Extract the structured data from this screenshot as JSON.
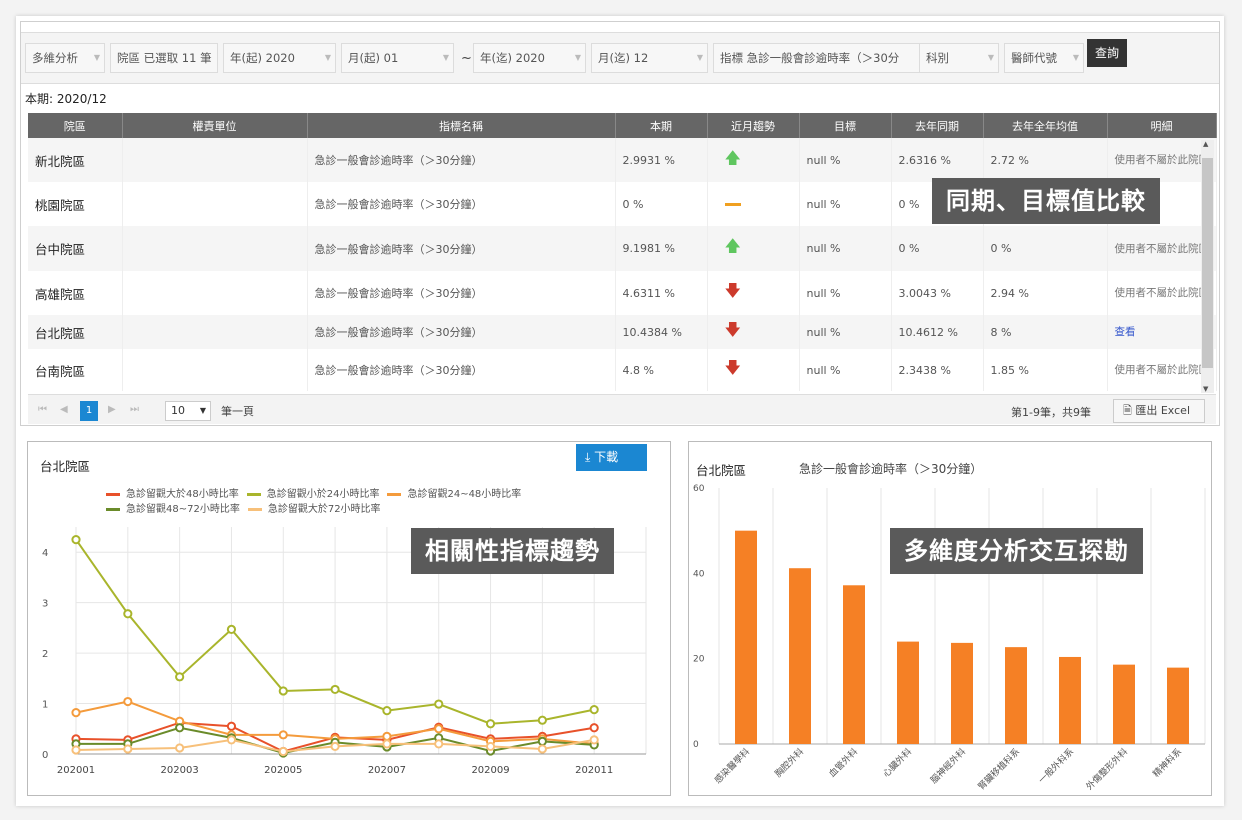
{
  "filters": {
    "dimension": "多維分析",
    "region": "院區 已選取 11 筆",
    "year_from": "年(起) 2020",
    "month_from": "月(起) 01",
    "tilde": "~",
    "year_to": "年(迄) 2020",
    "month_to": "月(迄) 12",
    "indicator": "指標  急診一般會診逾時率（＞30分",
    "dept": "科別",
    "doctor": "醫師代號",
    "query": "查詢"
  },
  "period": "本期: 2020/12",
  "table": {
    "headers": [
      "院區",
      "權責單位",
      "指標名稱",
      "本期",
      "近月趨勢",
      "目標",
      "去年同期",
      "去年全年均值",
      "明細"
    ],
    "rows": [
      {
        "region": "新北院區",
        "unit": "",
        "indicator": "急診一般會診逾時率（＞30分鐘）",
        "current": "2.9931 %",
        "trend": "up",
        "target": "null %",
        "last_year": "2.6316 %",
        "last_avg": "2.72 %",
        "detail": "使用者不屬於此院區",
        "detail_link": false
      },
      {
        "region": "桃園院區",
        "unit": "",
        "indicator": "急診一般會診逾時率（＞30分鐘）",
        "current": "0 %",
        "trend": "flat",
        "target": "null %",
        "last_year": "0 %",
        "last_avg": "",
        "detail": "",
        "detail_link": false
      },
      {
        "region": "台中院區",
        "unit": "",
        "indicator": "急診一般會診逾時率（＞30分鐘）",
        "current": "9.1981 %",
        "trend": "up",
        "target": "null %",
        "last_year": "0 %",
        "last_avg": "0 %",
        "detail": "使用者不屬於此院區",
        "detail_link": false
      },
      {
        "region": "高雄院區",
        "unit": "",
        "indicator": "急診一般會診逾時率（＞30分鐘）",
        "current": "4.6311 %",
        "trend": "down",
        "target": "null %",
        "last_year": "3.0043 %",
        "last_avg": "2.94 %",
        "detail": "使用者不屬於此院區",
        "detail_link": false
      },
      {
        "region": "台北院區",
        "unit": "",
        "indicator": "急診一般會診逾時率（＞30分鐘）",
        "current": "10.4384 %",
        "trend": "down",
        "target": "null %",
        "last_year": "10.4612 %",
        "last_avg": "8 %",
        "detail": "查看",
        "detail_link": true
      },
      {
        "region": "台南院區",
        "unit": "",
        "indicator": "急診一般會診逾時率（＞30分鐘）",
        "current": "4.8 %",
        "trend": "down",
        "target": "null %",
        "last_year": "2.3438 %",
        "last_avg": "1.85 %",
        "detail": "使用者不屬於此院區",
        "detail_link": false
      }
    ]
  },
  "pager": {
    "current_page": "1",
    "page_size": "10",
    "per_page_label": "筆一頁",
    "info": "第1-9筆，共9筆",
    "export": "匯出 Excel"
  },
  "overlays": {
    "compare": "同期、目標值比較",
    "trend": "相關性指標趨勢",
    "multi": "多維度分析交互探勘"
  },
  "colors": {
    "header": "#666666",
    "accent": "#1b87d2",
    "bar": "#f58025",
    "up": "#5fc65f",
    "down": "#cc3a2c"
  },
  "left_chart": {
    "title": "台北院區",
    "download": "下載",
    "chart_data": {
      "type": "line",
      "x": [
        "202001",
        "202002",
        "202003",
        "202004",
        "202005",
        "202006",
        "202007",
        "202008",
        "202009",
        "202010",
        "202011",
        "202012"
      ],
      "xticks": [
        "202001",
        "202003",
        "202005",
        "202007",
        "202009",
        "202011"
      ],
      "ylim": [
        0,
        4.5
      ],
      "yticks": [
        0,
        1,
        2,
        3,
        4
      ],
      "grid": true,
      "legend_position": "top",
      "series": [
        {
          "name": "急診留觀大於48小時比率",
          "color": "#e8512a",
          "values": [
            0.3,
            0.28,
            0.62,
            0.55,
            0.05,
            0.33,
            0.28,
            0.53,
            0.3,
            0.35,
            0.52
          ]
        },
        {
          "name": "急診留觀小於24小時比率",
          "color": "#a9b52c",
          "values": [
            4.25,
            2.78,
            1.53,
            2.47,
            1.25,
            1.28,
            0.86,
            0.99,
            0.6,
            0.67,
            0.88
          ]
        },
        {
          "name": "急診留觀24~48小時比率",
          "color": "#f49b3c",
          "values": [
            0.82,
            1.04,
            0.65,
            0.38,
            0.38,
            0.3,
            0.35,
            0.5,
            0.25,
            0.3,
            0.2
          ]
        },
        {
          "name": "急診留觀48~72小時比率",
          "color": "#6a8b2a",
          "values": [
            0.2,
            0.2,
            0.52,
            0.32,
            0.02,
            0.23,
            0.14,
            0.32,
            0.06,
            0.25,
            0.18
          ]
        },
        {
          "name": "急診留觀大於72小時比率",
          "color": "#f7c07a",
          "values": [
            0.08,
            0.1,
            0.12,
            0.28,
            0.05,
            0.15,
            0.2,
            0.2,
            0.15,
            0.1,
            0.28
          ]
        }
      ]
    }
  },
  "right_chart": {
    "title": "台北院區",
    "subtitle": "急診一般會診逾時率（＞30分鐘）",
    "chart_data": {
      "type": "bar",
      "categories": [
        "感染醫學科",
        "胸腔外科",
        "血管外科",
        "心臟外科",
        "腦神經外科",
        "腎臟移植科系",
        "一般外科系",
        "外傷整形外科",
        "精神科系"
      ],
      "values": [
        50,
        41.2,
        37.2,
        24,
        23.7,
        22.7,
        20.4,
        18.6,
        17.9
      ],
      "ylim": [
        0,
        60
      ],
      "yticks": [
        0,
        20,
        40,
        60
      ],
      "grid": true
    }
  }
}
